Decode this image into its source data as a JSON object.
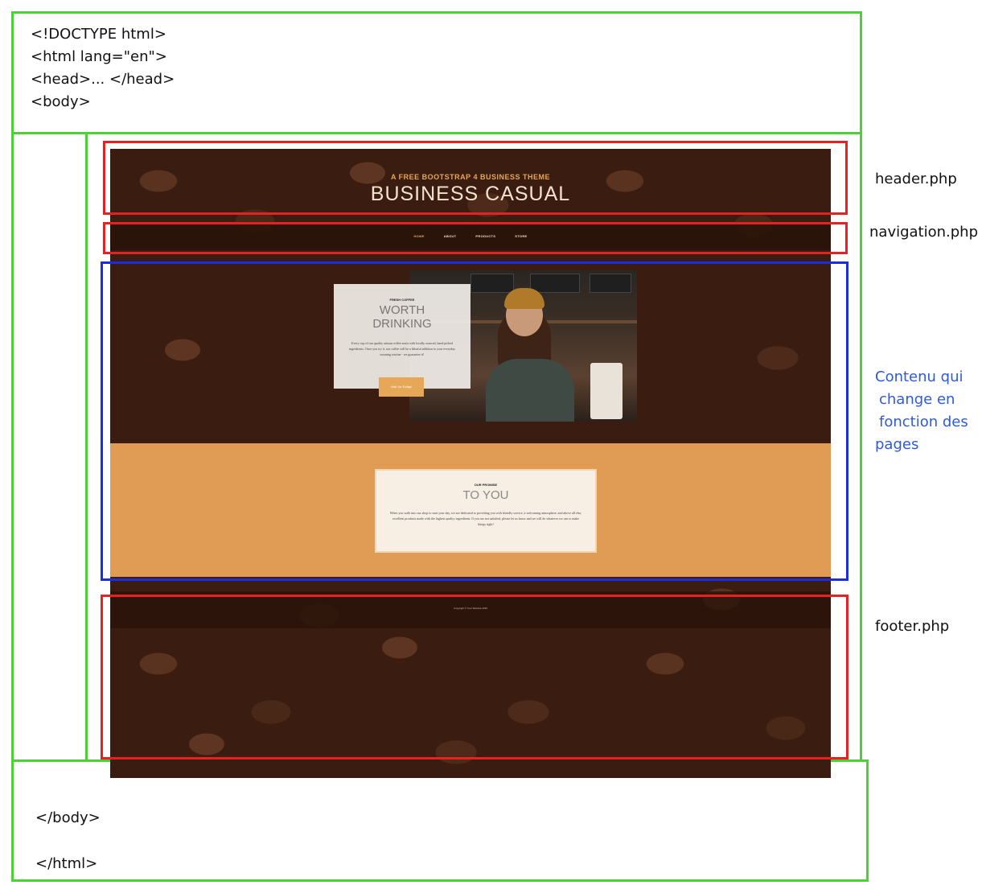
{
  "code_top": [
    "<!DOCTYPE html>",
    "<html lang=\"en\">",
    "<head>... </head>",
    "<body>"
  ],
  "code_bottom": {
    "body_close": "</body>",
    "html_close": "</html>"
  },
  "site": {
    "subtitle": "A FREE BOOTSTRAP 4 BUSINESS THEME",
    "title": "BUSINESS CASUAL",
    "nav": [
      {
        "label": "HOME",
        "active": true
      },
      {
        "label": "ABOUT",
        "active": false
      },
      {
        "label": "PRODUCTS",
        "active": false
      },
      {
        "label": "STORE",
        "active": false
      }
    ],
    "hero": {
      "eyebrow": "FRESH COFFEE",
      "heading_line1": "WORTH",
      "heading_line2": "DRINKING",
      "text": "Every cup of our quality artisan coffee starts with locally sourced, hand picked ingredients. Once you try it, our coffee will be a blissful addition to your everyday morning routine - we guarantee it!",
      "button": "Visit Us Today!"
    },
    "promise": {
      "eyebrow": "OUR PROMISE",
      "heading": "TO YOU",
      "text": "When you walk into our shop to start your day, we are dedicated to providing you with friendly service, a welcoming atmosphere, and above all else, excellent products made with the highest quality ingredients. If you are not satisfied, please let us know and we will do whatever we can to make things right!"
    },
    "footer": "Copyright © Your Website 2019"
  },
  "labels": {
    "header": "header.php",
    "navigation": "navigation.php",
    "content": [
      "Contenu qui",
      "change en",
      "fonction des",
      "pages"
    ],
    "footer": "footer.php"
  },
  "colors": {
    "document_outline": "#4cd137",
    "include_outline": "#e52222",
    "content_outline": "#1a2ee0",
    "accent": "#e6a756"
  }
}
